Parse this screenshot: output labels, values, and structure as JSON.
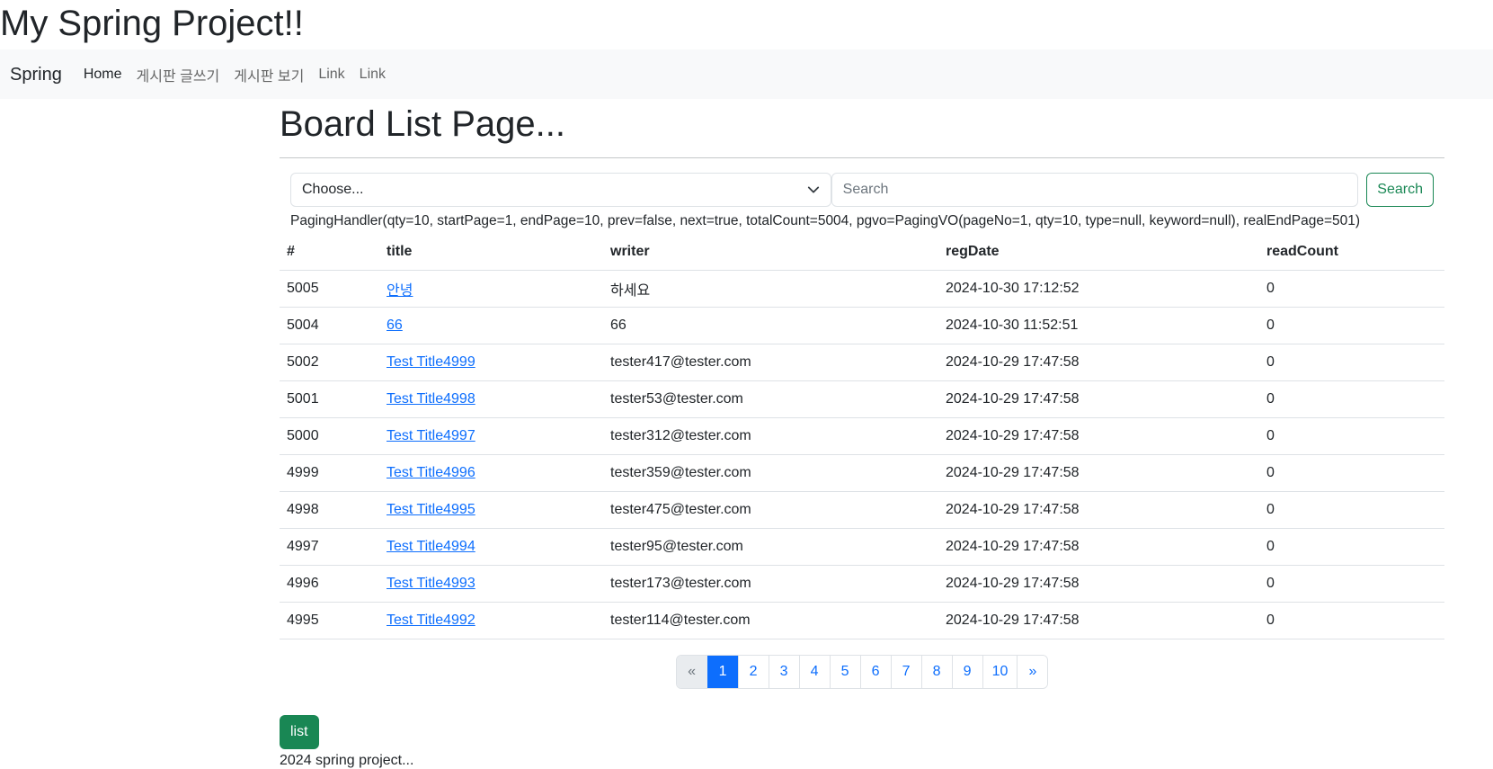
{
  "site": {
    "title": "My Spring Project!!"
  },
  "navbar": {
    "brand": "Spring",
    "links": [
      {
        "label": "Home",
        "active": true
      },
      {
        "label": "게시판 글쓰기"
      },
      {
        "label": "게시판 보기"
      },
      {
        "label": "Link"
      },
      {
        "label": "Link"
      }
    ]
  },
  "page": {
    "title": "Board List Page..."
  },
  "search": {
    "select_value": "Choose...",
    "input_placeholder": "Search",
    "button_label": "Search"
  },
  "paging_info": "PagingHandler(qty=10, startPage=1, endPage=10, prev=false, next=true, totalCount=5004, pgvo=PagingVO(pageNo=1, qty=10, type=null, keyword=null), realEndPage=501)",
  "table": {
    "headers": [
      "#",
      "title",
      "writer",
      "regDate",
      "readCount"
    ],
    "rows": [
      {
        "num": "5005",
        "title": "안녕",
        "writer": "하세요",
        "regDate": "2024-10-30 17:12:52",
        "readCount": "0"
      },
      {
        "num": "5004",
        "title": "66",
        "writer": "66",
        "regDate": "2024-10-30 11:52:51",
        "readCount": "0"
      },
      {
        "num": "5002",
        "title": "Test Title4999",
        "writer": "tester417@tester.com",
        "regDate": "2024-10-29 17:47:58",
        "readCount": "0"
      },
      {
        "num": "5001",
        "title": "Test Title4998",
        "writer": "tester53@tester.com",
        "regDate": "2024-10-29 17:47:58",
        "readCount": "0"
      },
      {
        "num": "5000",
        "title": "Test Title4997",
        "writer": "tester312@tester.com",
        "regDate": "2024-10-29 17:47:58",
        "readCount": "0"
      },
      {
        "num": "4999",
        "title": "Test Title4996",
        "writer": "tester359@tester.com",
        "regDate": "2024-10-29 17:47:58",
        "readCount": "0"
      },
      {
        "num": "4998",
        "title": "Test Title4995",
        "writer": "tester475@tester.com",
        "regDate": "2024-10-29 17:47:58",
        "readCount": "0"
      },
      {
        "num": "4997",
        "title": "Test Title4994",
        "writer": "tester95@tester.com",
        "regDate": "2024-10-29 17:47:58",
        "readCount": "0"
      },
      {
        "num": "4996",
        "title": "Test Title4993",
        "writer": "tester173@tester.com",
        "regDate": "2024-10-29 17:47:58",
        "readCount": "0"
      },
      {
        "num": "4995",
        "title": "Test Title4992",
        "writer": "tester114@tester.com",
        "regDate": "2024-10-29 17:47:58",
        "readCount": "0"
      }
    ]
  },
  "pagination": {
    "prev": "«",
    "pages": [
      "1",
      "2",
      "3",
      "4",
      "5",
      "6",
      "7",
      "8",
      "9",
      "10"
    ],
    "current": "1",
    "next": "»"
  },
  "list_button": "list",
  "footer": "2024 spring project..."
}
